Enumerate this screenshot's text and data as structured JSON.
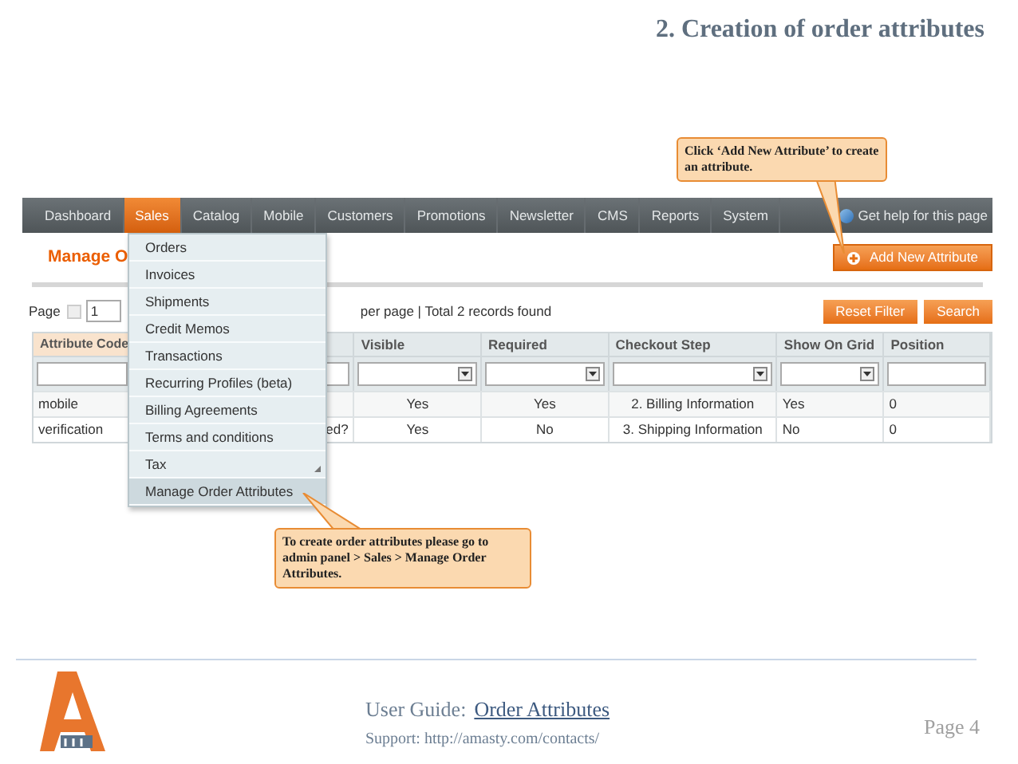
{
  "slide_title": "2. Creation of order attributes",
  "callouts": [
    {
      "text": "Click ‘Add New Attribute’ to create an attribute."
    },
    {
      "text": "To create order attributes please go to admin panel > Sales > Manage Order Attributes."
    }
  ],
  "nav": [
    {
      "label": "Dashboard",
      "selected": false
    },
    {
      "label": "Sales",
      "selected": true
    },
    {
      "label": "Catalog",
      "selected": false
    },
    {
      "label": "Mobile",
      "selected": false
    },
    {
      "label": "Customers",
      "selected": false
    },
    {
      "label": "Promotions",
      "selected": false
    },
    {
      "label": "Newsletter",
      "selected": false
    },
    {
      "label": "CMS",
      "selected": false
    },
    {
      "label": "Reports",
      "selected": false
    },
    {
      "label": "System",
      "selected": false
    }
  ],
  "help_link": "Get help for this page",
  "sales_menu": [
    {
      "label": "Orders",
      "selected": false,
      "submenu": false
    },
    {
      "label": "Invoices",
      "selected": false,
      "submenu": false
    },
    {
      "label": "Shipments",
      "selected": false,
      "submenu": false
    },
    {
      "label": "Credit Memos",
      "selected": false,
      "submenu": false
    },
    {
      "label": "Transactions",
      "selected": false,
      "submenu": false
    },
    {
      "label": "Recurring Profiles (beta)",
      "selected": false,
      "submenu": false
    },
    {
      "label": "Billing Agreements",
      "selected": false,
      "submenu": false
    },
    {
      "label": "Terms and conditions",
      "selected": false,
      "submenu": false
    },
    {
      "label": "Tax",
      "selected": false,
      "submenu": true
    },
    {
      "label": "Manage Order Attributes",
      "selected": true,
      "submenu": false
    }
  ],
  "page_heading": "Manage O",
  "add_button": "Add New Attribute",
  "pager": {
    "label": "Page",
    "value": "1",
    "info": "per page | Total 2 records found"
  },
  "buttons": [
    "Reset Filter",
    "Search"
  ],
  "table": {
    "columns": [
      {
        "label": "Attribute Code",
        "dropdown": false
      },
      {
        "dropdown": false
      },
      {
        "label": "Visible",
        "dropdown": true
      },
      {
        "label": "Required",
        "dropdown": true
      },
      {
        "label": "Checkout Step",
        "dropdown": true
      },
      {
        "label": "Show On Grid",
        "dropdown": true
      },
      {
        "label": "Position",
        "dropdown": false
      }
    ],
    "rows": [
      [
        "mobile",
        "",
        "Yes",
        "Yes",
        "2. Billing Information",
        "Yes",
        "0"
      ],
      [
        "verification",
        "ed?",
        "Yes",
        "No",
        "3. Shipping Information",
        "No",
        "0"
      ]
    ]
  },
  "footer": {
    "guide_label": "User Guide:",
    "guide_link": "Order Attributes",
    "support": "Support: http://amasty.com/contacts/",
    "page": "Page 4"
  }
}
